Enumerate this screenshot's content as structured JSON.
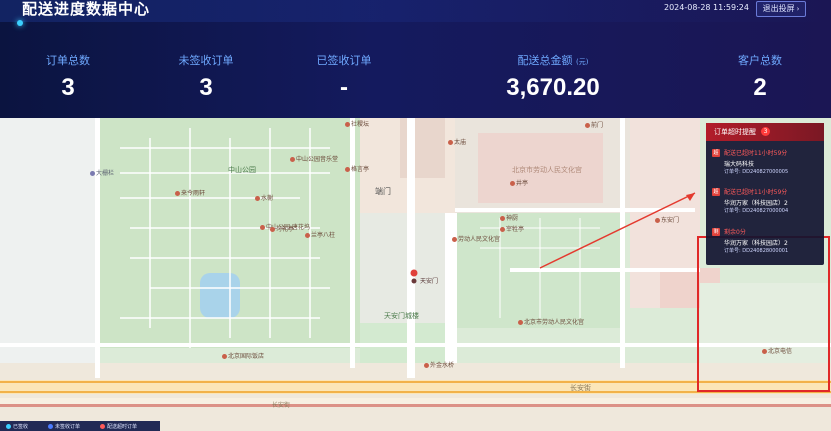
{
  "header": {
    "title": "配送进度数据中心",
    "datetime": "2024-08-28 11:59:24",
    "logout_label": "退出投屏"
  },
  "stats": [
    {
      "label": "订单总数",
      "unit": "",
      "value": "3"
    },
    {
      "label": "未签收订单",
      "unit": "",
      "value": "3"
    },
    {
      "label": "已签收订单",
      "unit": "",
      "value": "-"
    },
    {
      "label": "配送总金额",
      "unit": "(元)",
      "value": "3,670.20"
    },
    {
      "label": "客户总数",
      "unit": "",
      "value": "2"
    }
  ],
  "alert_panel": {
    "title": "订单超时提醒",
    "count": "3",
    "items": [
      {
        "icon": "超",
        "status": "配送已超时11小时59分",
        "customer": "瑞大码科技",
        "order": "订单号: DD240827000005"
      },
      {
        "icon": "超",
        "status": "配送已超时11小时59分",
        "customer": "华润万家（科技园店）2",
        "order": "订单号: DD240827000004"
      },
      {
        "icon": "剩",
        "status": "剩余0分",
        "customer": "华润万家（科技园店）2",
        "order": "订单号: DD240828000001"
      }
    ]
  },
  "map_labels": {
    "gate": "端门",
    "square": "天安门城楼",
    "park1": "中山公园",
    "museum": "北京市劳动人民文化宫",
    "tiananmen": "天安门",
    "pois": [
      "中山公园音乐堂",
      "格言亭",
      "来今雨轩",
      "中山公园·唐花坞",
      "水榭",
      "习礼亭",
      "兰亭八柱",
      "社稷坛",
      "神厨",
      "宰牲亭",
      "太庙",
      "井亭",
      "东安门",
      "北京市劳动人民文化宫",
      "劳动人民文化宫",
      "天安门",
      "外金水桥",
      "南池子大街",
      "长安街",
      "大栅栏",
      "前门",
      "北京国际饭店",
      "北京电信"
    ]
  },
  "legend": {
    "items": [
      {
        "label": "已签收",
        "color": "#3bd0ff"
      },
      {
        "label": "未签收订单",
        "color": "#4b7bff"
      },
      {
        "label": "配送超时订单",
        "color": "#ff5a5a"
      }
    ]
  },
  "colors": {
    "header_bg": "#141a5e",
    "stat_label": "#6fa9ff",
    "alert_red": "#e02828"
  }
}
